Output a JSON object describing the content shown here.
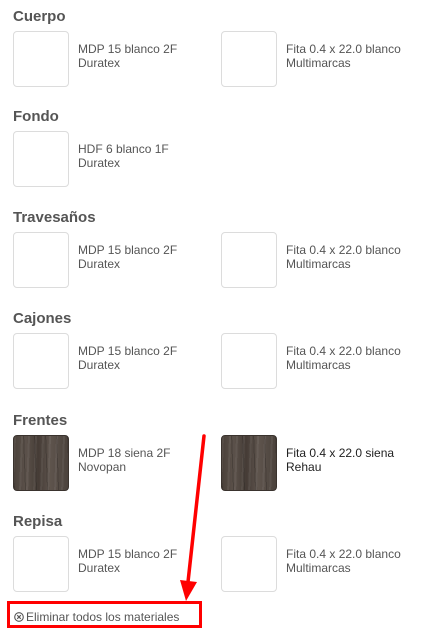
{
  "sections": [
    {
      "title": "Cuerpo",
      "items": [
        {
          "line1": "MDP 15 blanco 2F",
          "line2": "Duratex",
          "swatch": "white"
        },
        {
          "line1": "Fita 0.4 x 22.0 blanco",
          "line2": "Multimarcas",
          "swatch": "white"
        }
      ]
    },
    {
      "title": "Fondo",
      "items": [
        {
          "line1": "HDF 6 blanco 1F",
          "line2": "Duratex",
          "swatch": "white"
        }
      ]
    },
    {
      "title": "Travesaños",
      "items": [
        {
          "line1": "MDP 15 blanco 2F",
          "line2": "Duratex",
          "swatch": "white"
        },
        {
          "line1": "Fita 0.4 x 22.0 blanco",
          "line2": "Multimarcas",
          "swatch": "white"
        }
      ]
    },
    {
      "title": "Cajones",
      "items": [
        {
          "line1": "MDP 15 blanco 2F",
          "line2": "Duratex",
          "swatch": "white"
        },
        {
          "line1": "Fita 0.4 x 22.0 blanco",
          "line2": "Multimarcas",
          "swatch": "white"
        }
      ]
    },
    {
      "title": "Frentes",
      "items": [
        {
          "line1": "MDP 18 siena 2F",
          "line2": "Novopan",
          "swatch": "wood"
        },
        {
          "line1": "Fita 0.4 x 22.0 siena",
          "line2": "Rehau",
          "swatch": "wood"
        }
      ]
    },
    {
      "title": "Repisa",
      "items": [
        {
          "line1": "MDP 15 blanco 2F",
          "line2": "Duratex",
          "swatch": "white"
        },
        {
          "line1": "Fita 0.4 x 22.0 blanco",
          "line2": "Multimarcas",
          "swatch": "white"
        }
      ]
    }
  ],
  "remove_all": {
    "label": "Eliminar todos los materiales",
    "icon": "circle-x-icon"
  },
  "colors": {
    "text": "#555555",
    "annotation": "#ff0000",
    "wood_swatch": "#4f463f"
  }
}
